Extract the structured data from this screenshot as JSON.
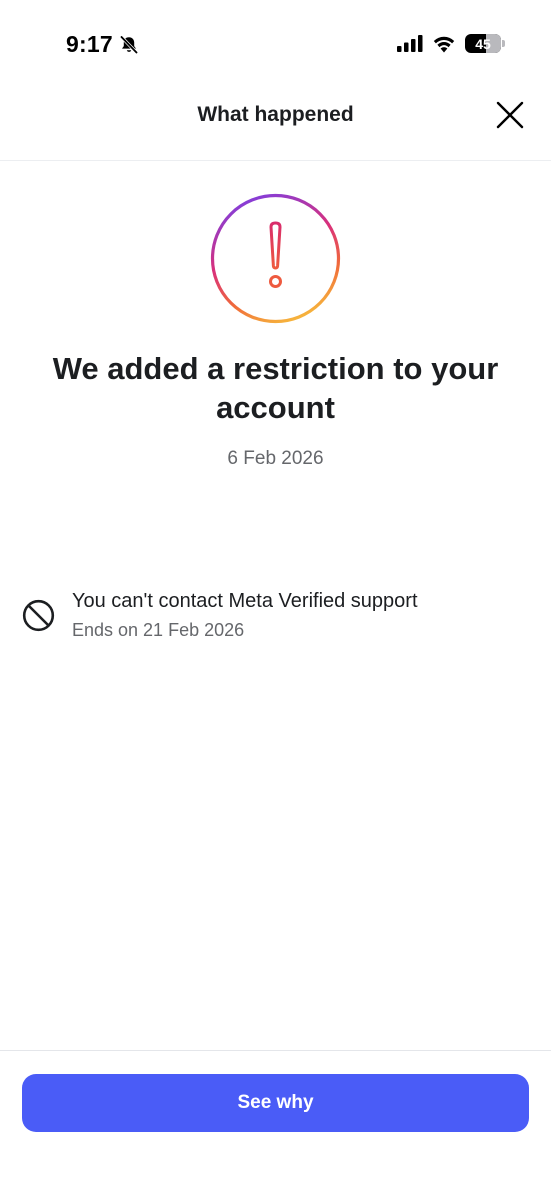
{
  "status_bar": {
    "time": "9:17",
    "battery_level": "45"
  },
  "header": {
    "title": "What happened"
  },
  "main": {
    "headline": "We added a restriction to your account",
    "date": "6 Feb 2026",
    "restriction": {
      "text": "You can't contact Meta Verified support",
      "ends": "Ends on 21 Feb 2026"
    }
  },
  "footer": {
    "button_label": "See why"
  },
  "colors": {
    "accent": "#4a5cf7",
    "secondary_text": "#65676b",
    "gradient": [
      "#7b3fe4",
      "#d9307a",
      "#f06a3a",
      "#f6b23c"
    ]
  },
  "icons": [
    "bell-muted-icon",
    "signal-icon",
    "wifi-icon",
    "battery-icon",
    "close-icon",
    "alert-icon",
    "block-icon"
  ]
}
